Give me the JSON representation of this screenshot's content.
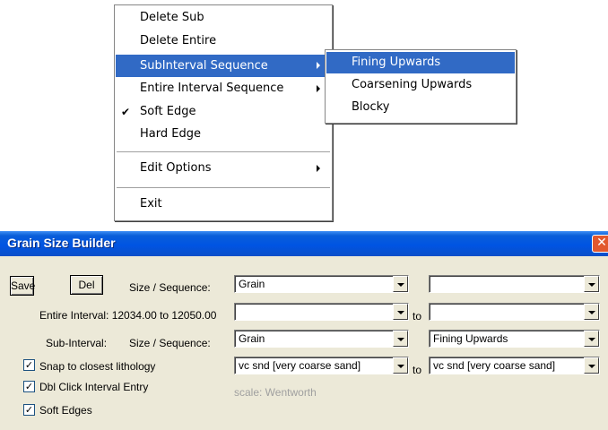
{
  "context_menu": {
    "items": [
      {
        "label": "Delete Sub"
      },
      {
        "label": "Delete Entire"
      },
      {
        "label": "SubInterval Sequence"
      },
      {
        "label": "Entire Interval Sequence"
      },
      {
        "label": "Soft Edge",
        "checked": true
      },
      {
        "label": "Hard Edge"
      },
      {
        "label": "Edit Options"
      },
      {
        "label": "Exit"
      }
    ],
    "check_glyph": "✔"
  },
  "submenu": {
    "items": [
      {
        "label": "Fining Upwards"
      },
      {
        "label": "Coarsening Upwards"
      },
      {
        "label": "Blocky"
      }
    ]
  },
  "dialog": {
    "title": "Grain Size Builder",
    "close_glyph": "✕",
    "save_label": "Save",
    "del_label": "Del",
    "size_sequence_label": "Size / Sequence:",
    "size_sequence_value": "Grain",
    "size_sequence_right_value": "",
    "entire_interval_label": "Entire Interval: 12034.00 to 12050.00",
    "entire_from_value": "",
    "to_label": "to",
    "entire_to_value": "",
    "sub_interval_label": "Sub-Interval:",
    "sub_size_sequence_label": "Size / Sequence:",
    "sub_size_value": "Grain",
    "sub_sequence_value": "Fining Upwards",
    "snap_label": "Snap to closest lithology",
    "snap_checked": true,
    "grain_from_value": "vc snd  [very coarse sand]",
    "to_label_2": "to",
    "grain_to_value": "vc snd  [very coarse sand]",
    "dbl_click_label": "Dbl Click Interval Entry",
    "dbl_click_checked": true,
    "scale_label": "scale: Wentworth",
    "soft_edges_label": "Soft Edges",
    "soft_edges_checked": true,
    "check_glyph": "✓"
  },
  "colors": {
    "menu_highlight": "#316ac5",
    "titlebar": "#0054e3",
    "dialog_bg": "#ece9d8",
    "close_button": "#e2582e"
  }
}
